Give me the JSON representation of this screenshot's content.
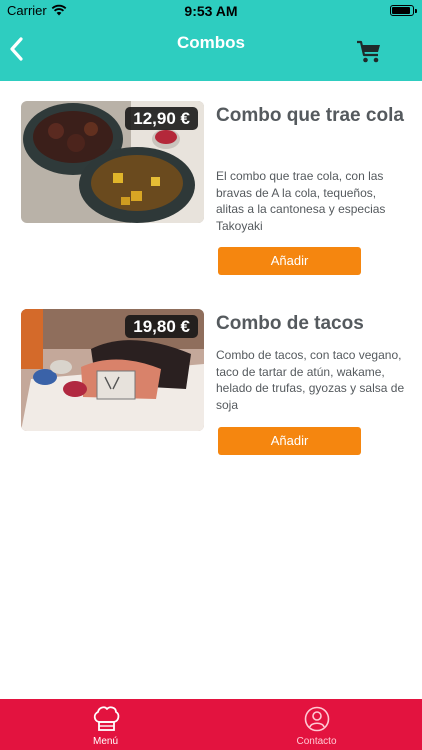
{
  "status_bar": {
    "carrier": "Carrier",
    "time": "9:53 AM"
  },
  "nav": {
    "title": "Combos"
  },
  "products": [
    {
      "price": "12,90 €",
      "title": "Combo que trae cola",
      "description": "El combo que trae cola, con las bravas de A la cola, tequeños, alitas a la cantonesa y especias Takoyaki",
      "button_label": "Añadir"
    },
    {
      "price": "19,80 €",
      "title": "Combo de tacos",
      "description": "Combo de tacos, con taco vegano, taco de tartar de atún, wakame, helado de trufas, gyozas y salsa de soja",
      "button_label": "Añadir"
    }
  ],
  "tab_bar": {
    "menu_label": "Menú",
    "contact_label": "Contacto"
  },
  "colors": {
    "header": "#2ecdc0",
    "accent_button": "#f5860f",
    "tab_bar": "#e3133f",
    "text": "#555a5e"
  },
  "icons": {
    "back": "chevron-left-icon",
    "cart": "cart-icon",
    "menu_tab": "chef-hat-icon",
    "contact_tab": "contact-person-icon"
  }
}
